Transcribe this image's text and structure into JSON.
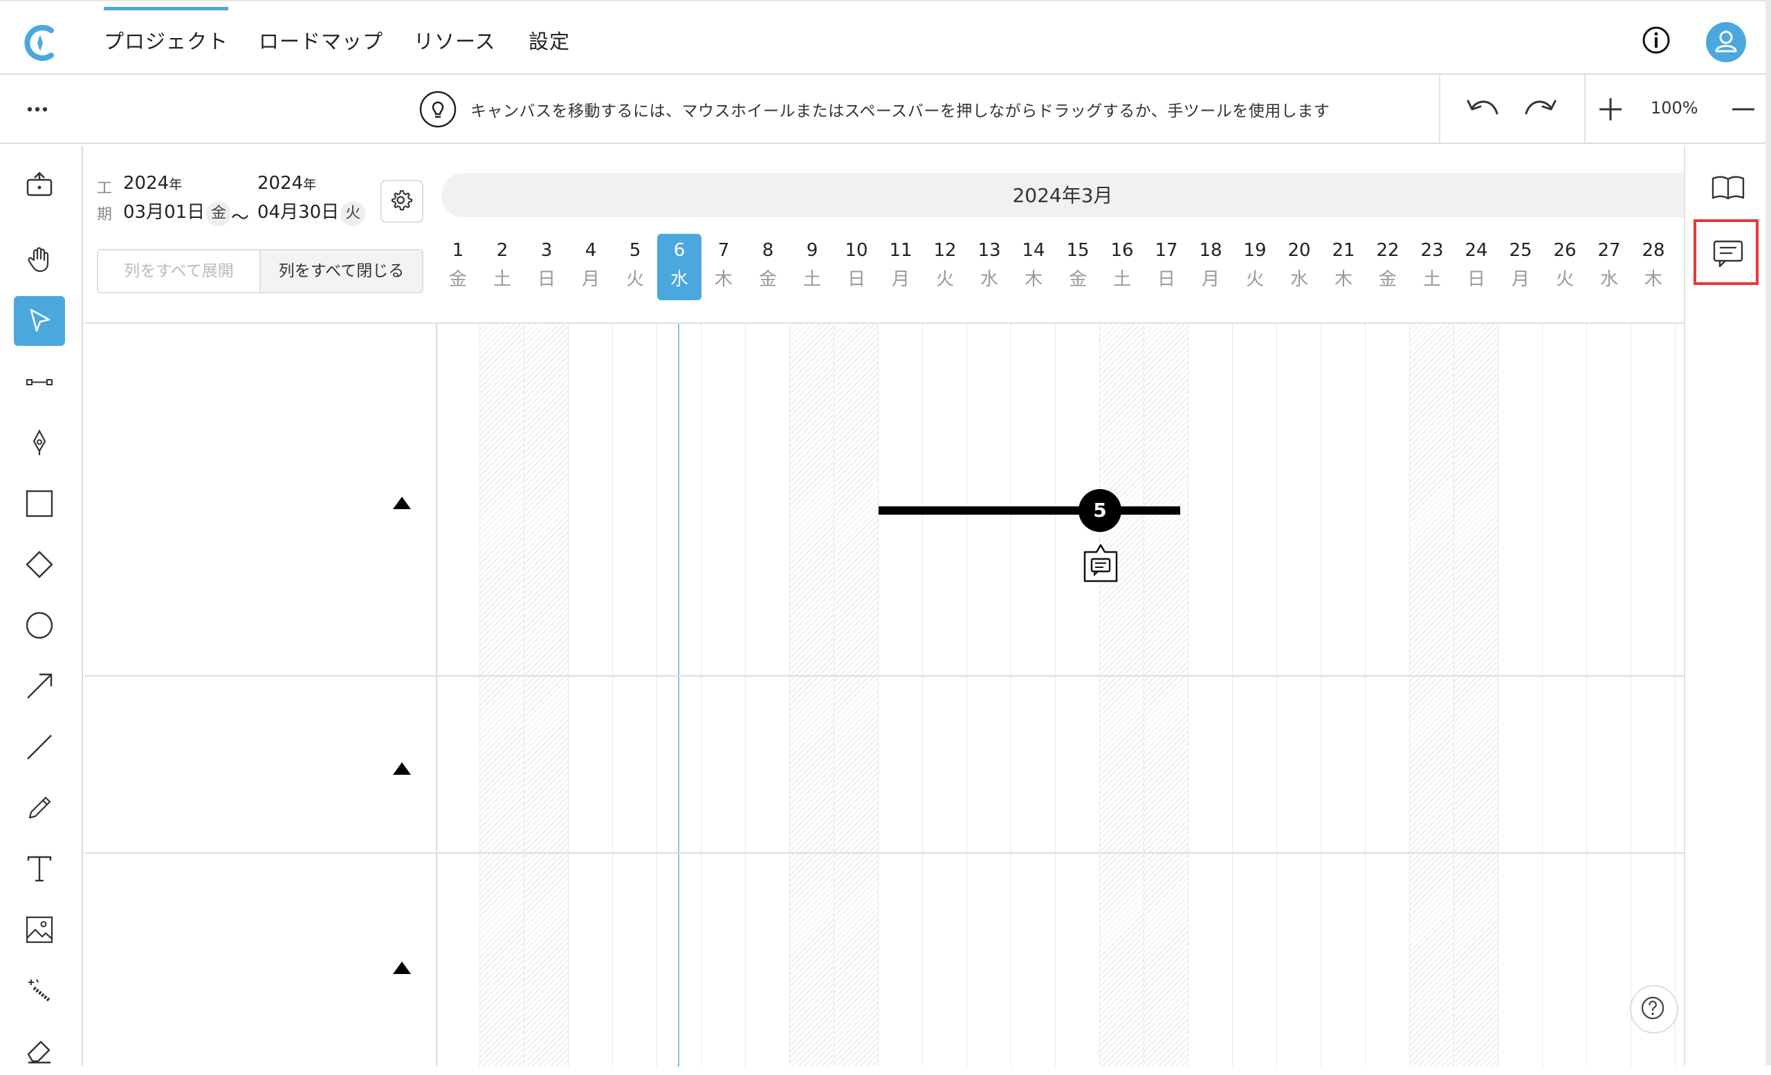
{
  "header": {
    "tabs": [
      {
        "label": "プロジェクト",
        "active": true
      },
      {
        "label": "ロードマップ",
        "active": false
      },
      {
        "label": "リソース",
        "active": false
      },
      {
        "label": "設定",
        "active": false
      }
    ],
    "accent_color": "#4aa8de"
  },
  "toolbar": {
    "hint": "キャンバスを移動するには、マウスホイールまたはスペースバーを押しながらドラッグするか、手ツールを使用します",
    "zoom": "100%"
  },
  "tools": [
    "export-icon",
    "hand-icon",
    "pointer-icon",
    "connector-icon",
    "pen-icon",
    "rectangle-icon",
    "diamond-icon",
    "circle-icon",
    "arrow-icon",
    "line-icon",
    "pencil-icon",
    "text-icon",
    "image-icon",
    "magic-wand-icon",
    "eraser-icon"
  ],
  "gantt": {
    "period_label_1": "工",
    "period_label_2": "期",
    "start_year": "2024",
    "start_year_suffix": "年",
    "start_date": "03月01日",
    "start_dow": "金",
    "tilde": "〜",
    "end_year": "2024",
    "end_year_suffix": "年",
    "end_date": "04月30日",
    "end_dow": "火",
    "expand_all": "列をすべて展開",
    "collapse_all": "列をすべて閉じる",
    "month": "2024年3月",
    "today_index": 5,
    "days": [
      {
        "num": "1",
        "dow": "金"
      },
      {
        "num": "2",
        "dow": "土"
      },
      {
        "num": "3",
        "dow": "日"
      },
      {
        "num": "4",
        "dow": "月"
      },
      {
        "num": "5",
        "dow": "火"
      },
      {
        "num": "6",
        "dow": "水"
      },
      {
        "num": "7",
        "dow": "木"
      },
      {
        "num": "8",
        "dow": "金"
      },
      {
        "num": "9",
        "dow": "土"
      },
      {
        "num": "10",
        "dow": "日"
      },
      {
        "num": "11",
        "dow": "月"
      },
      {
        "num": "12",
        "dow": "火"
      },
      {
        "num": "13",
        "dow": "水"
      },
      {
        "num": "14",
        "dow": "木"
      },
      {
        "num": "15",
        "dow": "金"
      },
      {
        "num": "16",
        "dow": "土"
      },
      {
        "num": "17",
        "dow": "日"
      },
      {
        "num": "18",
        "dow": "月"
      },
      {
        "num": "19",
        "dow": "火"
      },
      {
        "num": "20",
        "dow": "水"
      },
      {
        "num": "21",
        "dow": "木"
      },
      {
        "num": "22",
        "dow": "金"
      },
      {
        "num": "23",
        "dow": "土"
      },
      {
        "num": "24",
        "dow": "日"
      },
      {
        "num": "25",
        "dow": "月"
      },
      {
        "num": "26",
        "dow": "火"
      },
      {
        "num": "27",
        "dow": "水"
      },
      {
        "num": "28",
        "dow": "木"
      }
    ],
    "milestone_label": "5"
  },
  "right_sidebar": {
    "icons": [
      "book-icon",
      "comment-icon"
    ],
    "highlight_color": "#e53935"
  }
}
